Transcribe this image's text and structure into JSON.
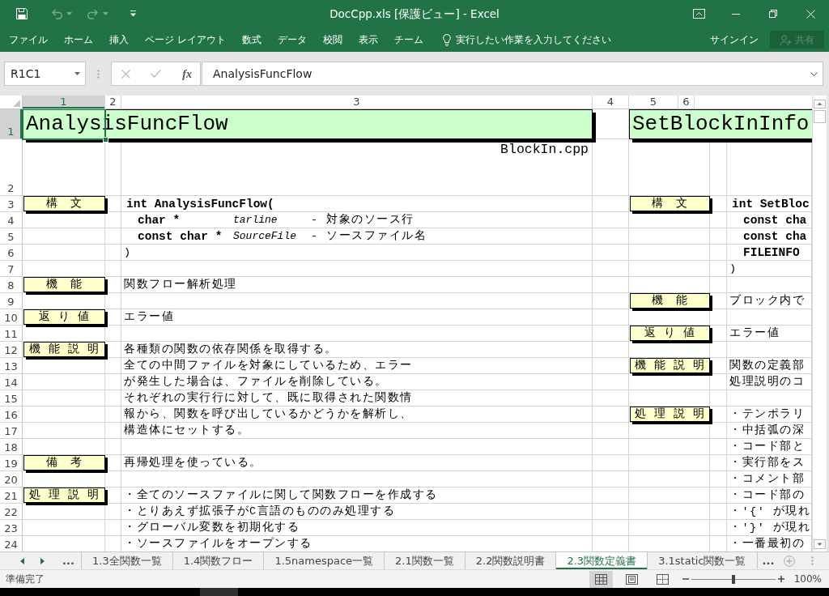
{
  "window": {
    "title": "DocCpp.xls [保護ビュー] - Excel"
  },
  "quick_access": [
    {
      "kind": "save",
      "disabled": false
    },
    {
      "kind": "undo",
      "disabled": true
    },
    {
      "kind": "redo",
      "disabled": true
    },
    {
      "kind": "customize",
      "disabled": false
    }
  ],
  "ribbon": {
    "tabs": [
      {
        "label": "ファイル",
        "selected": false
      },
      {
        "label": "ホーム",
        "selected": false
      },
      {
        "label": "挿入",
        "selected": false
      },
      {
        "label": "ページ レイアウト",
        "selected": false
      },
      {
        "label": "数式",
        "selected": false
      },
      {
        "label": "データ",
        "selected": false
      },
      {
        "label": "校閲",
        "selected": false
      },
      {
        "label": "表示",
        "selected": false
      },
      {
        "label": "チーム",
        "selected": false
      }
    ],
    "tell_me": "実行したい作業を入力してください",
    "sign_in": "サインイン",
    "share": {
      "label": "共有",
      "disabled": true
    }
  },
  "formula_bar": {
    "name_box": "R1C1",
    "function_button": "fx",
    "formula": "AnalysisFuncFlow"
  },
  "sheet": {
    "columns": [
      {
        "label": "1",
        "selected": true
      },
      {
        "label": "2",
        "selected": false
      },
      {
        "label": "3",
        "selected": false
      },
      {
        "label": "4",
        "selected": false
      },
      {
        "label": "5",
        "selected": false
      },
      {
        "label": "6",
        "selected": false
      }
    ],
    "rows": [
      {
        "label": "1",
        "selected": true
      },
      {
        "label": "2",
        "selected": false
      },
      {
        "label": "3",
        "selected": false
      },
      {
        "label": "4",
        "selected": false
      },
      {
        "label": "5",
        "selected": false
      },
      {
        "label": "6",
        "selected": false
      },
      {
        "label": "7",
        "selected": false
      },
      {
        "label": "8",
        "selected": false
      },
      {
        "label": "9",
        "selected": false
      },
      {
        "label": "10",
        "selected": false
      },
      {
        "label": "11",
        "selected": false
      },
      {
        "label": "12",
        "selected": false
      },
      {
        "label": "13",
        "selected": false
      },
      {
        "label": "14",
        "selected": false
      },
      {
        "label": "15",
        "selected": false
      },
      {
        "label": "16",
        "selected": false
      },
      {
        "label": "17",
        "selected": false
      },
      {
        "label": "18",
        "selected": false
      },
      {
        "label": "19",
        "selected": false
      },
      {
        "label": "20",
        "selected": false
      },
      {
        "label": "21",
        "selected": false
      },
      {
        "label": "22",
        "selected": false
      },
      {
        "label": "23",
        "selected": false
      },
      {
        "label": "24",
        "selected": false
      }
    ],
    "entries": [
      {
        "title": "AnalysisFuncFlow",
        "file": "BlockIn.cpp",
        "sections": [
          {
            "label": "構　文",
            "lines": [
              {
                "kind": "signature",
                "text": "int AnalysisFuncFlow("
              },
              {
                "kind": "param",
                "type": "char *",
                "name": "tarline",
                "description": "- 対象のソース行"
              },
              {
                "kind": "param",
                "type": "const char *",
                "name": "SourceFile",
                "description": "- ソースファイル名"
              },
              {
                "kind": "close",
                "text": ")"
              }
            ]
          },
          {
            "label": "機　能",
            "lines": [
              {
                "kind": "text",
                "text": "関数フロー解析処理"
              }
            ]
          },
          {
            "label": "返 り 値",
            "lines": [
              {
                "kind": "text",
                "text": "エラー値"
              }
            ]
          },
          {
            "label": "機 能 説 明",
            "lines": [
              {
                "kind": "text",
                "text": "各種類の関数の依存関係を取得する。"
              },
              {
                "kind": "text",
                "text": "全ての中間ファイルを対象にしているため、エラー"
              },
              {
                "kind": "text",
                "text": "が発生した場合は、ファイルを削除している。"
              },
              {
                "kind": "text",
                "text": "それぞれの実行行に対して、既に取得された関数情"
              },
              {
                "kind": "text",
                "text": "報から、関数を呼び出しているかどうかを解析し、"
              },
              {
                "kind": "text",
                "text": "構造体にセットする。"
              }
            ]
          },
          {
            "label": "備　考",
            "lines": [
              {
                "kind": "text",
                "text": "再帰処理を使っている。"
              }
            ]
          },
          {
            "label": "処 理 説 明",
            "lines": [
              {
                "kind": "text",
                "text": "・全てのソースファイルに関して関数フローを作成する"
              },
              {
                "kind": "text",
                "text": "・とりあえず拡張子がC言語のもののみ処理する"
              },
              {
                "kind": "text",
                "text": "・グローバル変数を初期化する"
              },
              {
                "kind": "text",
                "text": "・ソースファイルをオープンする"
              }
            ]
          }
        ]
      },
      {
        "title": "SetBlockInInfo",
        "sections": [
          {
            "label": "構　文",
            "lines": [
              {
                "kind": "signature",
                "text": "int SetBloc"
              },
              {
                "kind": "param",
                "type": "const cha"
              },
              {
                "kind": "param",
                "type": "const cha"
              },
              {
                "kind": "param",
                "type": "FILEINFO"
              },
              {
                "kind": "close",
                "text": ")"
              }
            ]
          },
          {
            "label": "機　能",
            "lines": [
              {
                "kind": "text",
                "text": "ブロック内で"
              }
            ]
          },
          {
            "label": "返 り 値",
            "lines": [
              {
                "kind": "text",
                "text": "エラー値"
              }
            ]
          },
          {
            "label": "機 能 説 明",
            "lines": [
              {
                "kind": "text",
                "text": "関数の定義部"
              },
              {
                "kind": "text",
                "text": "処理説明のコ"
              }
            ]
          },
          {
            "label": "処 理 説 明",
            "lines": [
              {
                "kind": "text",
                "text": "・テンポラリ"
              },
              {
                "kind": "text",
                "text": "・中括弧の深"
              },
              {
                "kind": "text",
                "text": "・コード部と"
              },
              {
                "kind": "text",
                "text": "・実行部をス"
              },
              {
                "kind": "text",
                "text": "・コメント部"
              },
              {
                "kind": "text",
                "text": "・コード部の"
              },
              {
                "kind": "text",
                "text": "・'{' が現れ"
              },
              {
                "kind": "text",
                "text": "・'}' が現れ"
              },
              {
                "kind": "text",
                "text": "・一番最初の"
              }
            ]
          }
        ]
      }
    ]
  },
  "sheet_tabs": {
    "more_left": "...",
    "tabs": [
      {
        "label": "1.3全関数一覧",
        "selected": false
      },
      {
        "label": "1.4関数フロー",
        "selected": false
      },
      {
        "label": "1.5namespace一覧",
        "selected": false
      },
      {
        "label": "2.1関数一覧",
        "selected": false
      },
      {
        "label": "2.2関数説明書",
        "selected": false
      },
      {
        "label": "2.3関数定義書",
        "selected": true
      },
      {
        "label": "3.1static関数一覧",
        "selected": false
      }
    ],
    "more_right": "..."
  },
  "status_bar": {
    "text": "準備完了",
    "views": [
      {
        "kind": "normal",
        "selected": true
      },
      {
        "kind": "page_layout",
        "selected": false
      },
      {
        "kind": "page_break",
        "selected": false
      }
    ],
    "zoom": {
      "level": 0.5,
      "reading": "100%"
    }
  }
}
